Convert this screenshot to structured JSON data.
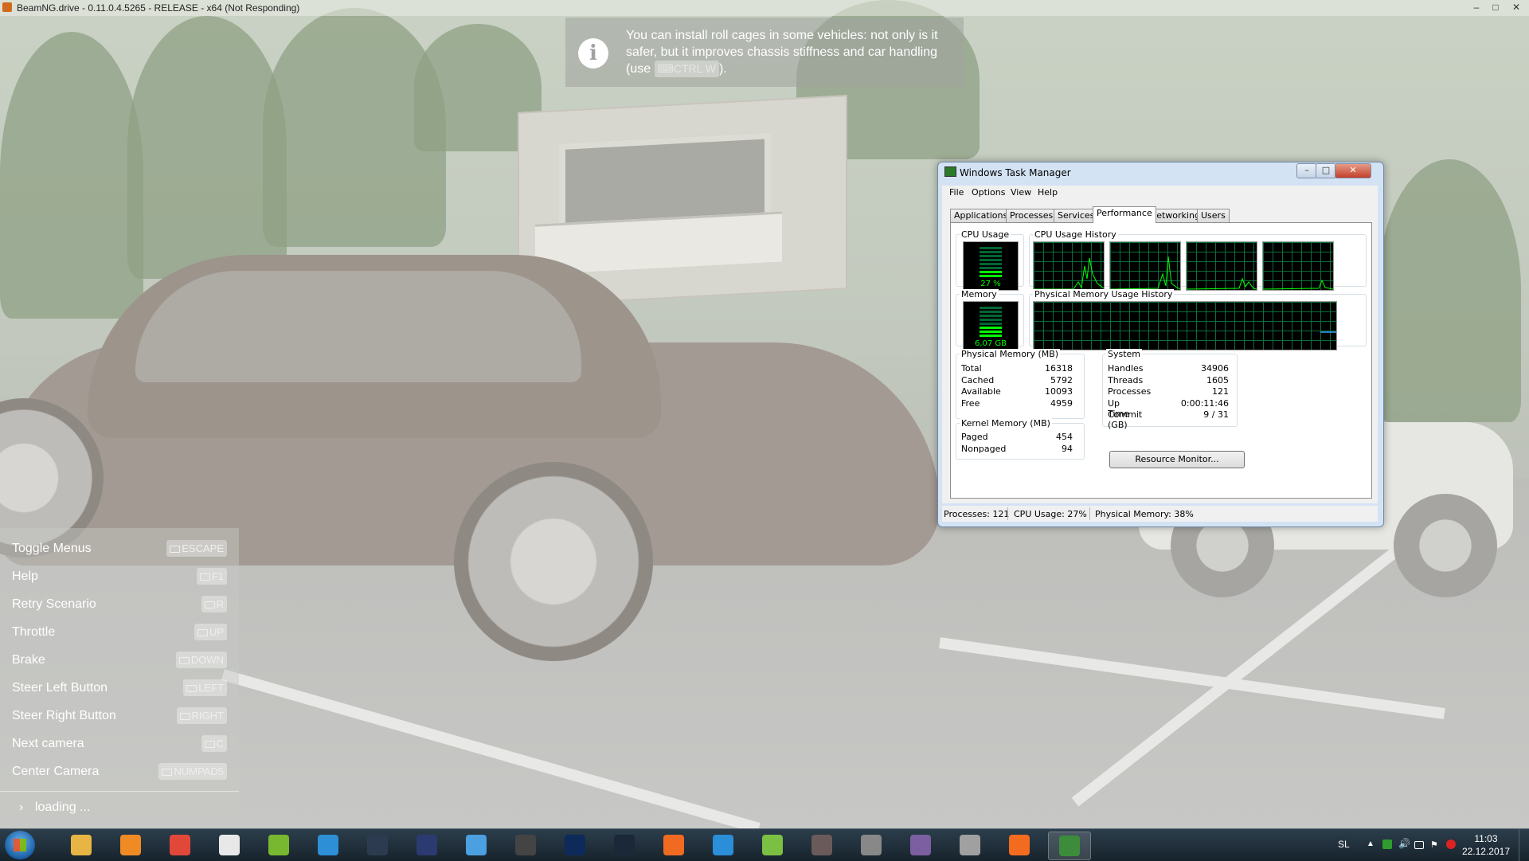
{
  "game_window": {
    "title": "BeamNG.drive - 0.11.0.4.5265 - RELEASE - x64 (Not Responding)",
    "controls": {
      "minimize": "–",
      "maximize": "□",
      "close": "✕"
    }
  },
  "tip": {
    "icon": "i",
    "text_before": "You can install roll cages in some vehicles: not only is it safer, but it improves chassis stiffness and car handling (use",
    "key": "CTRL W",
    "text_after": ")."
  },
  "help_menu": {
    "items": [
      {
        "label": "Toggle Menus",
        "key": "ESCAPE"
      },
      {
        "label": "Help",
        "key": "F1"
      },
      {
        "label": "Retry Scenario",
        "key": "R"
      },
      {
        "label": "Throttle",
        "key": "UP"
      },
      {
        "label": "Brake",
        "key": "DOWN"
      },
      {
        "label": "Steer Left Button",
        "key": "LEFT"
      },
      {
        "label": "Steer Right Button",
        "key": "RIGHT"
      },
      {
        "label": "Next camera",
        "key": "C"
      },
      {
        "label": "Center Camera",
        "key": "NUMPAD5"
      }
    ],
    "loading": {
      "chevron": "›",
      "text": "loading ..."
    }
  },
  "task_manager": {
    "title": "Windows Task Manager",
    "menu": [
      "File",
      "Options",
      "View",
      "Help"
    ],
    "tabs": [
      "Applications",
      "Processes",
      "Services",
      "Performance",
      "Networking",
      "Users"
    ],
    "active_tab": "Performance",
    "cpu_usage": {
      "label": "CPU Usage",
      "value": "27 %",
      "level": 0.27
    },
    "cpu_history": {
      "label": "CPU Usage History"
    },
    "memory": {
      "label": "Memory",
      "value": "6,07 GB",
      "level": 0.38
    },
    "memory_history": {
      "label": "Physical Memory Usage History"
    },
    "physical_memory": {
      "label": "Physical Memory (MB)",
      "rows": [
        {
          "k": "Total",
          "v": "16318"
        },
        {
          "k": "Cached",
          "v": "5792"
        },
        {
          "k": "Available",
          "v": "10093"
        },
        {
          "k": "Free",
          "v": "4959"
        }
      ]
    },
    "kernel_memory": {
      "label": "Kernel Memory (MB)",
      "rows": [
        {
          "k": "Paged",
          "v": "454"
        },
        {
          "k": "Nonpaged",
          "v": "94"
        }
      ]
    },
    "system": {
      "label": "System",
      "rows": [
        {
          "k": "Handles",
          "v": "34906"
        },
        {
          "k": "Threads",
          "v": "1605"
        },
        {
          "k": "Processes",
          "v": "121"
        },
        {
          "k": "Up Time",
          "v": "0:00:11:46"
        },
        {
          "k": "Commit (GB)",
          "v": "9 / 31"
        }
      ]
    },
    "resource_monitor_button": "Resource Monitor...",
    "status": {
      "processes": "Processes: 121",
      "cpu": "CPU Usage: 27%",
      "memory": "Physical Memory: 38%"
    }
  },
  "taskbar": {
    "apps": [
      {
        "name": "explorer-icon",
        "color": "#e8b544"
      },
      {
        "name": "media-player-icon",
        "color": "#f08a24"
      },
      {
        "name": "chrome-icon",
        "color": "#e2483a"
      },
      {
        "name": "corsair-icon",
        "color": "#e8e8e8"
      },
      {
        "name": "utorrent-icon",
        "color": "#78b830"
      },
      {
        "name": "tiles-icon",
        "color": "#2d8fd5"
      },
      {
        "name": "lightroom-icon",
        "color": "#2c3b4f"
      },
      {
        "name": "mail-icon",
        "color": "#2b3a70"
      },
      {
        "name": "vs-icon",
        "color": "#4aa0e0"
      },
      {
        "name": "film-icon",
        "color": "#444"
      },
      {
        "name": "photoshop-icon",
        "color": "#0d2a5a"
      },
      {
        "name": "steam-icon",
        "color": "#1b2838"
      },
      {
        "name": "origin-icon",
        "color": "#f06a22"
      },
      {
        "name": "uplay-icon",
        "color": "#2a8ed8"
      },
      {
        "name": "bluestacks-icon",
        "color": "#7bc043"
      },
      {
        "name": "game-icon",
        "color": "#6b5a5a"
      },
      {
        "name": "settings-icon",
        "color": "#888"
      },
      {
        "name": "tool-icon",
        "color": "#7c5fa0"
      },
      {
        "name": "truck-icon",
        "color": "#a0a0a0"
      },
      {
        "name": "beamng-icon",
        "color": "#f26b1f"
      },
      {
        "name": "taskmgr-icon",
        "color": "#3c8c3c"
      }
    ],
    "active_app": "taskmgr-icon",
    "tray": {
      "language": "SL",
      "time": "11:03",
      "date": "22.12.2017"
    }
  }
}
